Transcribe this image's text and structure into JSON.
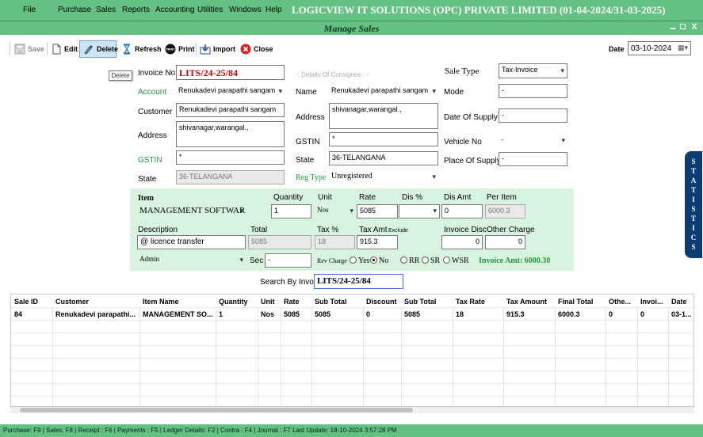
{
  "menu": [
    "File",
    "Purchase",
    "Sales",
    "Reports",
    "Accounting",
    "Utilities",
    "Windows",
    "Help"
  ],
  "company": "LOGICVIEW IT SOLUTIONS (OPC) PRIVATE LIMITED (01-04-2024/31-03-2025)",
  "window": {
    "title": "Manage Sales",
    "close": "X"
  },
  "toolbar": {
    "save": "Save",
    "edit": "Edit",
    "delete": "Delete",
    "refresh": "Refresh",
    "print": "Print",
    "import": "Import",
    "close": "Close",
    "print_icon_text": "PRINT",
    "tooltip": "Delete",
    "date_label": "Date",
    "date_value": "03-10-2024"
  },
  "form": {
    "invoice_no_label": "Invoice No",
    "invoice_no": "LITS/24-25/84",
    "account_label": "Account",
    "account": "Renukadevi parapathi sangam",
    "customer_label": "Customer",
    "customer": "Renukadevi parapathi sangam",
    "address_label": "Address",
    "address": "shivanagar,warangal.,",
    "gstin_label": "GSTIN",
    "gstin": "*",
    "state_label": "State",
    "state": "36-TELANGANA",
    "consignee_header": "-: Details Of Consignee : -",
    "c_name_label": "Name",
    "c_name": "Renukadevi parapathi sangam",
    "c_address_label": "Address",
    "c_address": "shivanagar,warangal.,",
    "c_gstin_label": "GSTIN",
    "c_gstin": "*",
    "c_state_label": "State",
    "c_state": "36-TELANGANA",
    "reg_type_label": "Reg Type",
    "reg_type": "Unregistered",
    "sale_type_label": "Sale Type",
    "sale_type": "Tax-Invoice",
    "mode_label": "Mode",
    "mode": "-",
    "date_supply_label": "Date Of Supply",
    "date_supply": "-",
    "vehicle_label": "Vehicle No",
    "vehicle": "-",
    "place_label": "Place Of Supply",
    "place": "-"
  },
  "item": {
    "item_label": "Item",
    "item": "MANAGEMENT SOFTWAR",
    "qty_label": "Quantity",
    "qty": "1",
    "unit_label": "Unit",
    "unit": "Nos",
    "rate_label": "Rate",
    "rate": "5085",
    "dis_label": "Dis %",
    "dis": "",
    "dis_amt_label": "Dis Amt",
    "dis_amt": "0",
    "per_item_label": "Per Item",
    "per_item": "6000.3",
    "desc_label": "Description",
    "desc": "@ licence transfer",
    "total_label": "Total",
    "total": "5085",
    "tax_pct_label": "Tax %",
    "tax_pct": "18",
    "tax_amt_label": "Tax Amt",
    "exclude_label": "Exclude",
    "tax_amt": "915.3",
    "inv_disc_label": "Invoice Disc",
    "inv_disc": "0",
    "other_charge_label": "Other Charge",
    "other_charge": "0",
    "user": "Admin",
    "sec_label": "Sec",
    "sec": "-",
    "rev_charge_label": "Rev Charge",
    "rev_yes": "Yes",
    "rev_no": "No",
    "rr": "RR",
    "sr": "SR",
    "wsr": "WSR",
    "invoice_amt": "Invoice Amt: 6000.30"
  },
  "search": {
    "label": "Search By Invoice",
    "value": "LITS/24-25/84"
  },
  "stats_tab": [
    "S",
    "T",
    "A",
    "T",
    "I",
    "S",
    "T",
    "I",
    "C",
    "S"
  ],
  "grid": {
    "headers": [
      "Sale ID",
      "Customer",
      "Item Name",
      "Quantity",
      "Unit",
      "Rate",
      "Sub Total",
      "Discount",
      "Sub Total",
      "Tax Rate",
      "Tax Amount",
      "Final Total",
      "Othe...",
      "Invoi...",
      "Date"
    ],
    "rows": [
      [
        "84",
        "Renukadevi parapathi...",
        "MANAGEMENT SO...",
        "1",
        "Nos",
        "5085",
        "5085",
        "0",
        "5085",
        "18",
        "915.3",
        "6000.3",
        "0",
        "0",
        "03-1..."
      ]
    ]
  },
  "status": "Purchase: F9  |  Sales: F8  |  Receipt : F6  |  Payments : F5  |  Ledger Details: F2  |  Contra : F4  |  Journal : F7   Last Update: 18-10-2024  3:57:28 PM"
}
